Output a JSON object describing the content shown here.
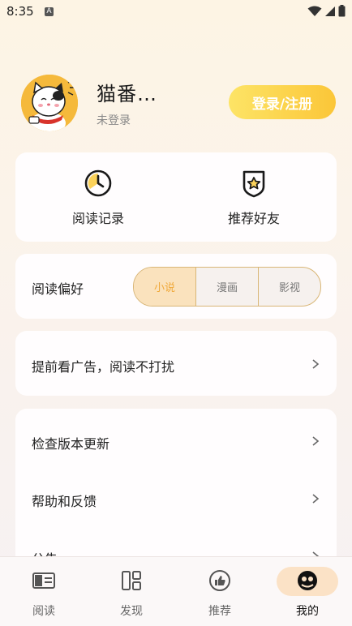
{
  "status_bar": {
    "time": "8:35",
    "a_icon": "A"
  },
  "profile": {
    "name": "猫番…",
    "status": "未登录",
    "login_button": "登录/注册"
  },
  "quick_actions": [
    {
      "label": "阅读记录",
      "icon": "clock-icon"
    },
    {
      "label": "推荐好友",
      "icon": "star-badge-icon"
    }
  ],
  "preference": {
    "label": "阅读偏好",
    "options": [
      "小说",
      "漫画",
      "影视"
    ],
    "selected": "小说"
  },
  "ad_row": {
    "label": "提前看广告，阅读不打扰"
  },
  "settings": [
    {
      "label": "检查版本更新"
    },
    {
      "label": "帮助和反馈"
    },
    {
      "label": "公告"
    }
  ],
  "bottom_nav": [
    {
      "label": "阅读",
      "icon": "book-icon"
    },
    {
      "label": "发现",
      "icon": "grid-icon"
    },
    {
      "label": "推荐",
      "icon": "thumb-up-icon"
    },
    {
      "label": "我的",
      "icon": "profile-icon",
      "active": true
    }
  ],
  "colors": {
    "accent": "#fbc638",
    "accent_light": "#fae2bd",
    "accent_text": "#f0a93a"
  }
}
